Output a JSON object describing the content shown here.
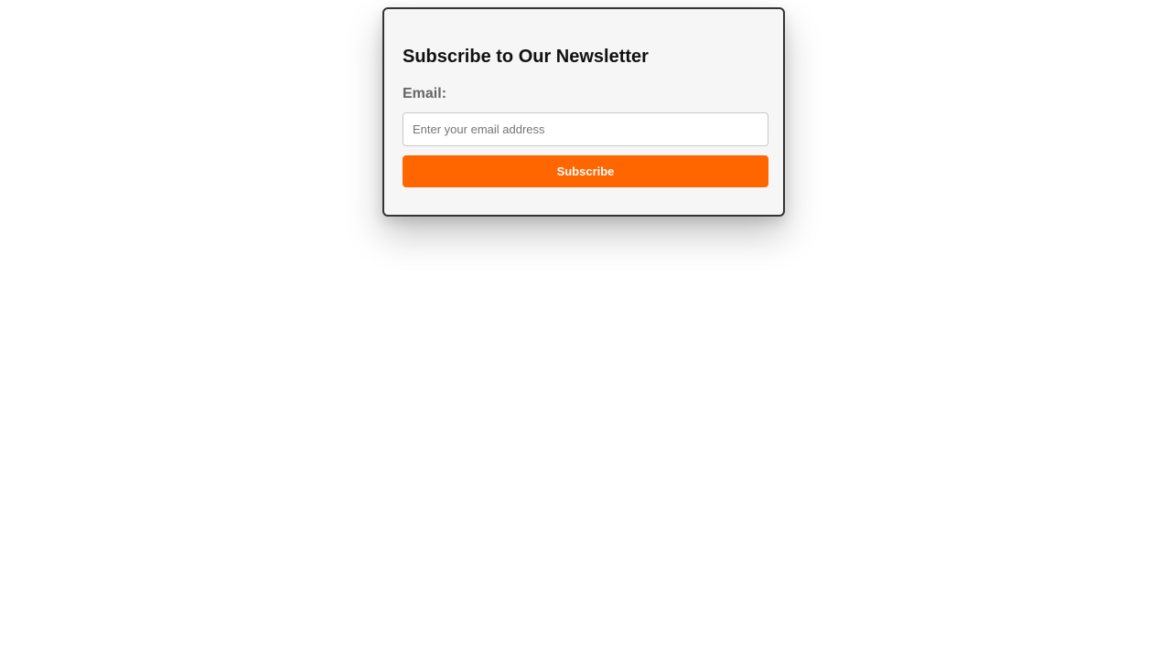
{
  "newsletter": {
    "title": "Subscribe to Our Newsletter",
    "email_label": "Email:",
    "email_value": "",
    "email_placeholder": "Enter your email address",
    "subscribe_label": "Subscribe"
  },
  "colors": {
    "accent": "#ff6600",
    "card_background": "#f6f6f6",
    "card_border": "#333333",
    "label_text": "#666666"
  }
}
